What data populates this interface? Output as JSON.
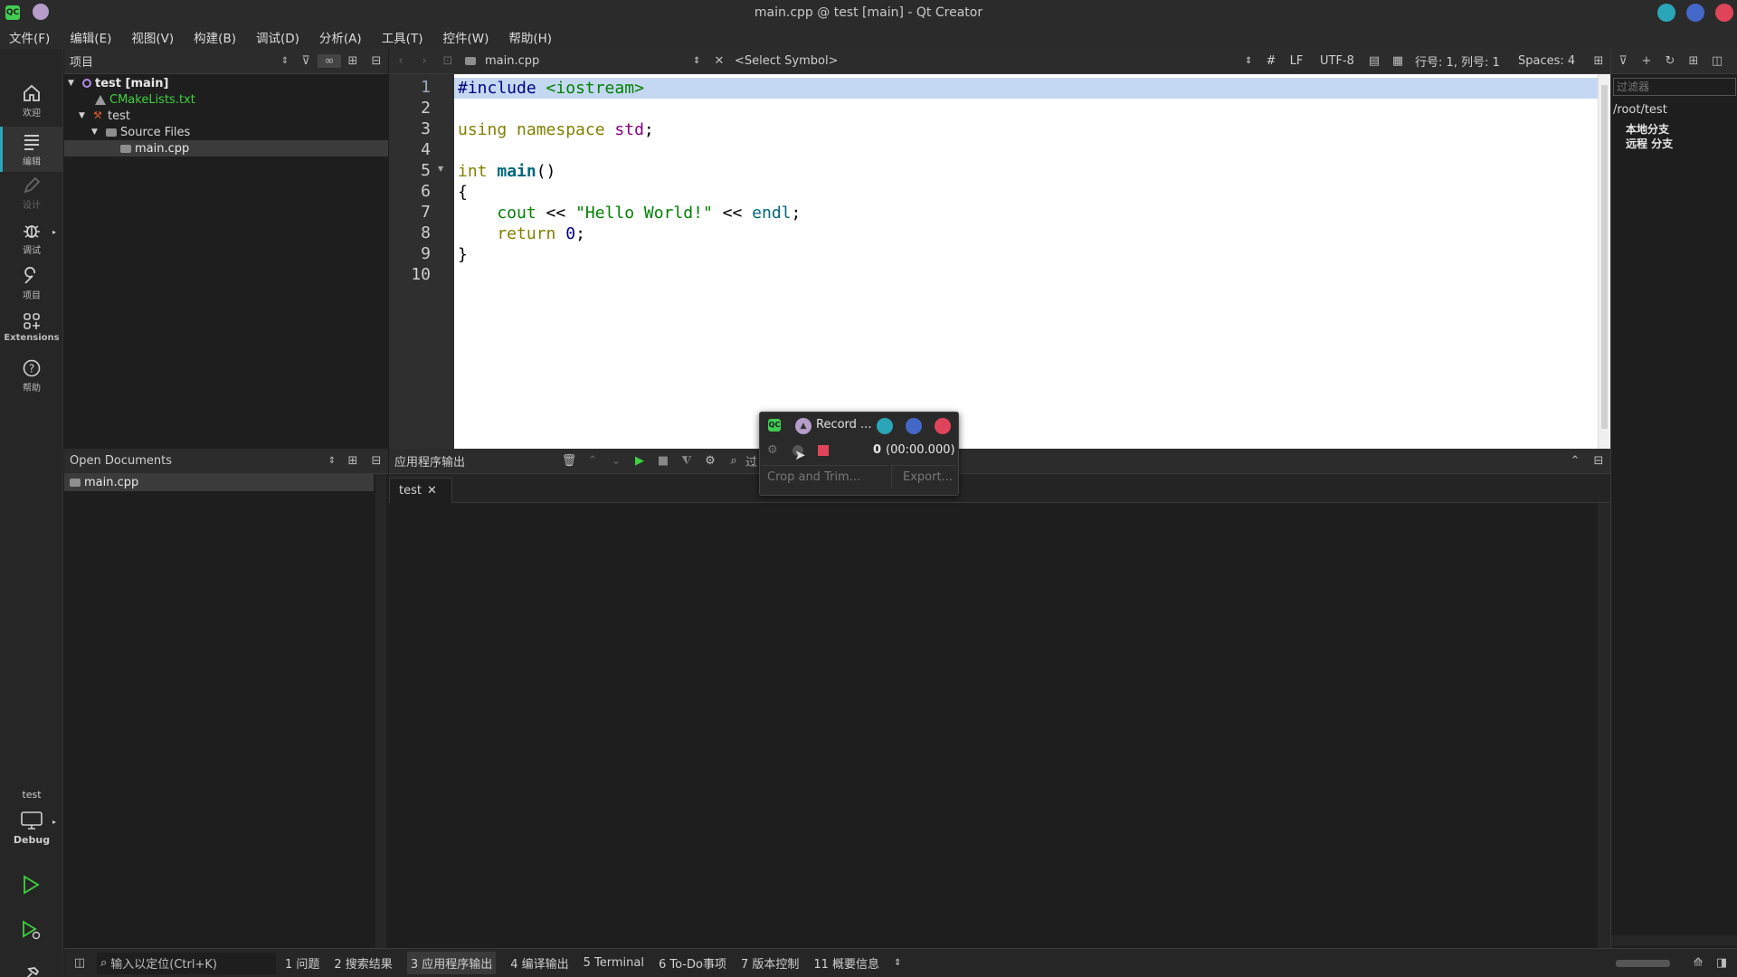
{
  "window": {
    "title": "main.cpp @ test [main] - Qt Creator",
    "logo": "QC",
    "btn_colors": [
      "#2aa6b8",
      "#4468c8",
      "#e0445a"
    ],
    "app_dot_color": "#b59cc9"
  },
  "menu": [
    "文件(F)",
    "编辑(E)",
    "视图(V)",
    "构建(B)",
    "调试(D)",
    "分析(A)",
    "工具(T)",
    "控件(W)",
    "帮助(H)"
  ],
  "modes": [
    {
      "label": "欢迎",
      "icon": "home-icon"
    },
    {
      "label": "编辑",
      "icon": "edit-icon",
      "active": true
    },
    {
      "label": "设计",
      "icon": "design-icon",
      "disabled": true
    },
    {
      "label": "调试",
      "icon": "bug-icon"
    },
    {
      "label": "项目",
      "icon": "wrench-icon"
    },
    {
      "label": "Extensions",
      "icon": "extensions-icon"
    },
    {
      "label": "帮助",
      "icon": "help-icon"
    }
  ],
  "kit": {
    "project": "test",
    "config": "Debug"
  },
  "project": {
    "header": "项目",
    "tree": [
      {
        "label": "test [main]",
        "bold": true,
        "depth": 0
      },
      {
        "label": "CMakeLists.txt",
        "depth": 1,
        "color": "#3fd13f"
      },
      {
        "label": "test",
        "depth": 1
      },
      {
        "label": "Source Files",
        "depth": 2
      },
      {
        "label": "main.cpp",
        "depth": 3,
        "selected": true
      }
    ]
  },
  "open_docs": {
    "header": "Open Documents",
    "items": [
      "main.cpp"
    ]
  },
  "editor": {
    "file": "main.cpp",
    "symbol": "<Select Symbol>",
    "hash": "#",
    "line_ending": "LF",
    "encoding": "UTF-8",
    "position": "行号: 1, 列号: 1",
    "indent": "Spaces: 4",
    "line_numbers": [
      "1",
      "2",
      "3",
      "4",
      "5",
      "6",
      "7",
      "8",
      "9",
      "10"
    ]
  },
  "code_tokens": {
    "l1a": "#include",
    "l1b": " <iostream>",
    "l3a": "using",
    "l3b": " namespace ",
    "l3c": "std",
    ";": ";",
    "l5a": "int",
    "l5b": " main",
    "l5c": "()",
    "l6": "{",
    "l7a": "    cout",
    "l7b": " << ",
    "l7c": "\"Hello World!\"",
    "l7d": " << ",
    "l7e": "endl",
    "l8a": "    return ",
    "l8b": "0",
    "l9": "}"
  },
  "git": {
    "filter_placeholder": "过滤器",
    "path": "/root/test",
    "items": [
      "本地分支",
      "远程 分支"
    ]
  },
  "output": {
    "header": "应用程序输出",
    "filter_label": "过",
    "tab": "test"
  },
  "recorder": {
    "title": "Record ...",
    "counter": "0",
    "time": "(00:00.000)",
    "crop": "Crop and Trim...",
    "export": "Export..."
  },
  "status": {
    "locator": "输入以定位(Ctrl+K)",
    "panes": [
      {
        "label": "1 问题"
      },
      {
        "label": "2 搜索结果"
      },
      {
        "label": "3 应用程序输出",
        "active": true
      },
      {
        "label": "4 编译输出"
      },
      {
        "label": "5 Terminal"
      },
      {
        "label": "6 To-Do事项"
      },
      {
        "label": "7 版本控制"
      },
      {
        "label": "11 概要信息"
      }
    ]
  }
}
